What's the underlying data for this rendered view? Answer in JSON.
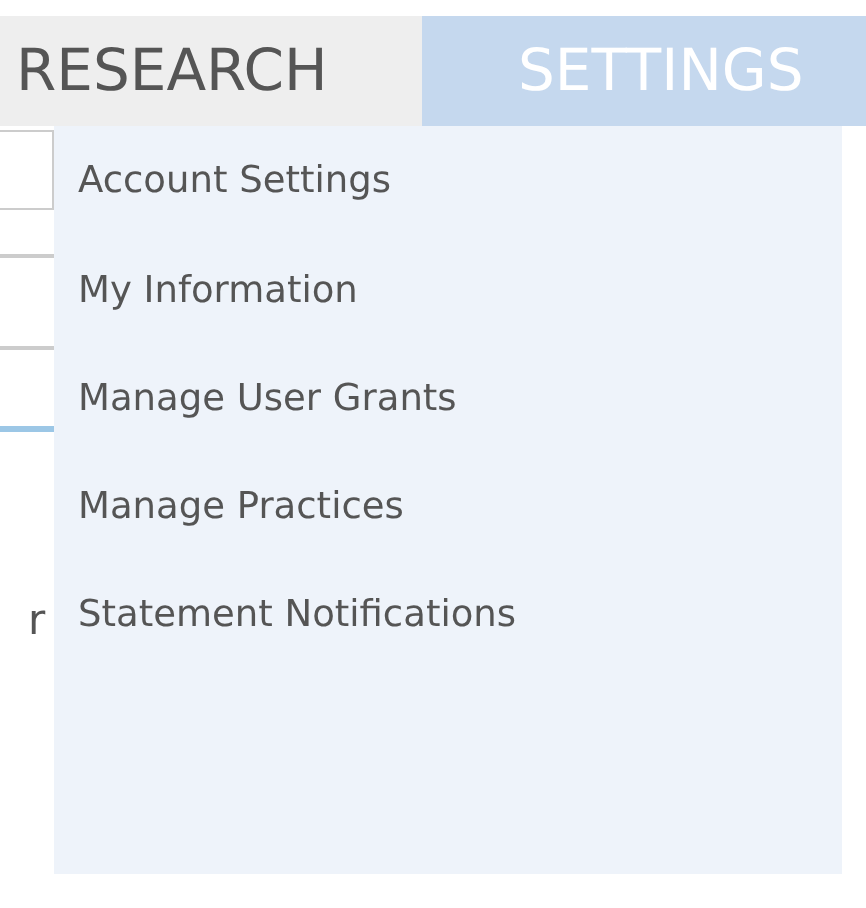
{
  "tabs": [
    {
      "label": "RESEARCH",
      "selected": false
    },
    {
      "label": "SETTINGS",
      "selected": true
    }
  ],
  "menu": {
    "items": [
      {
        "label": "Account Settings"
      },
      {
        "label": "My Information"
      },
      {
        "label": "Manage User Grants"
      },
      {
        "label": "Manage Practices"
      },
      {
        "label": "Statement Notifications"
      }
    ]
  },
  "background_text": "r"
}
